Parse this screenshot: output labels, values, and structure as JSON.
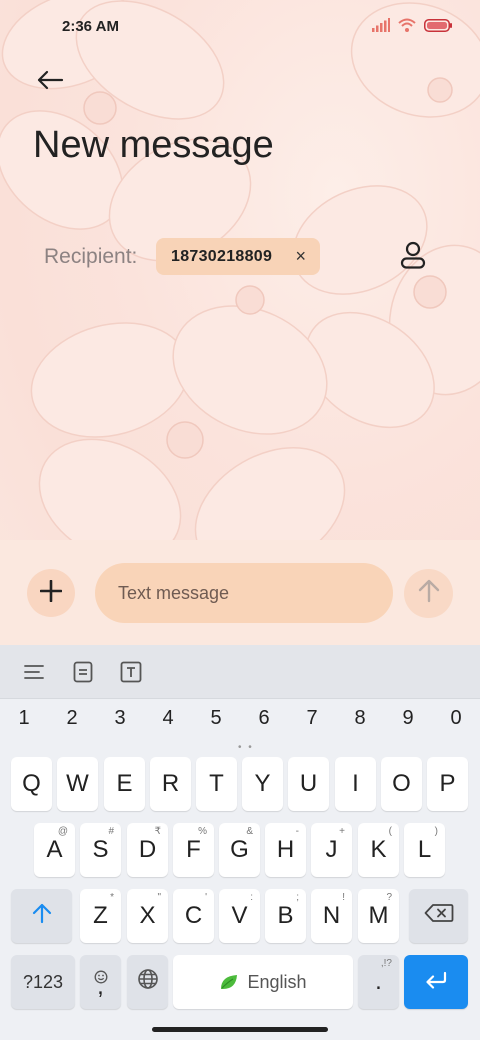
{
  "status_bar": {
    "time": "2:36 AM"
  },
  "header": {
    "title": "New message"
  },
  "recipient": {
    "label": "Recipient:",
    "chips": [
      {
        "number": "18730218809",
        "remove_glyph": "×"
      }
    ]
  },
  "compose": {
    "placeholder": "Text message"
  },
  "icons": {
    "back": "back-arrow-icon",
    "contact": "contact-person-icon",
    "add": "plus-icon",
    "send": "send-arrow-icon",
    "signal": "signal-bars-icon",
    "wifi": "wifi-icon",
    "battery": "battery-icon"
  },
  "keyboard": {
    "number_row": [
      "1",
      "2",
      "3",
      "4",
      "5",
      "6",
      "7",
      "8",
      "9",
      "0"
    ],
    "row1": [
      {
        "key": "Q"
      },
      {
        "key": "W"
      },
      {
        "key": "E"
      },
      {
        "key": "R"
      },
      {
        "key": "T"
      },
      {
        "key": "Y"
      },
      {
        "key": "U"
      },
      {
        "key": "I"
      },
      {
        "key": "O"
      },
      {
        "key": "P"
      }
    ],
    "row2": [
      {
        "key": "A",
        "sub": "@"
      },
      {
        "key": "S",
        "sub": "#"
      },
      {
        "key": "D",
        "sub": "₹"
      },
      {
        "key": "F",
        "sub": "%"
      },
      {
        "key": "G",
        "sub": "&"
      },
      {
        "key": "H",
        "sub": "-"
      },
      {
        "key": "J",
        "sub": "+"
      },
      {
        "key": "K",
        "sub": "("
      },
      {
        "key": "L",
        "sub": ")"
      }
    ],
    "row3": [
      {
        "key": "Z",
        "sub": "*"
      },
      {
        "key": "X",
        "sub": "\""
      },
      {
        "key": "C",
        "sub": "'"
      },
      {
        "key": "V",
        "sub": ":"
      },
      {
        "key": "B",
        "sub": ";"
      },
      {
        "key": "N",
        "sub": "!"
      },
      {
        "key": "M",
        "sub": "?"
      }
    ],
    "symbols_label": "?123",
    "comma_label": ",",
    "space_label": "English",
    "period_label": ".",
    "period_sub": ",!?"
  },
  "colors": {
    "accent": "#1a8cf0",
    "chip_bg": "#f8d3b7",
    "input_bg": "#f9d4b8"
  }
}
